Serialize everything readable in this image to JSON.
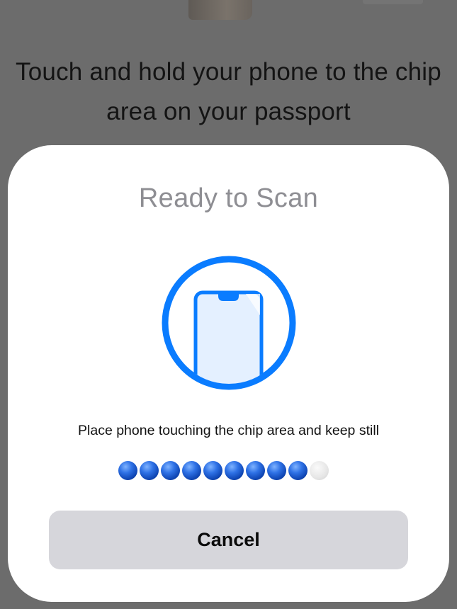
{
  "background": {
    "instruction": "Touch and hold your phone to the chip area on your passport"
  },
  "sheet": {
    "title": "Ready to Scan",
    "scan_icon": "phone-scan-icon",
    "instruction": "Place phone touching the chip area  and keep still",
    "progress": {
      "filled": 9,
      "total": 10
    },
    "cancel_label": "Cancel"
  },
  "colors": {
    "accent": "#0a7cff",
    "dimmed_background": "#6c6c6c",
    "sheet_background": "#ffffff",
    "title_text": "#8e8e93",
    "cancel_button": "#d6d6db"
  }
}
